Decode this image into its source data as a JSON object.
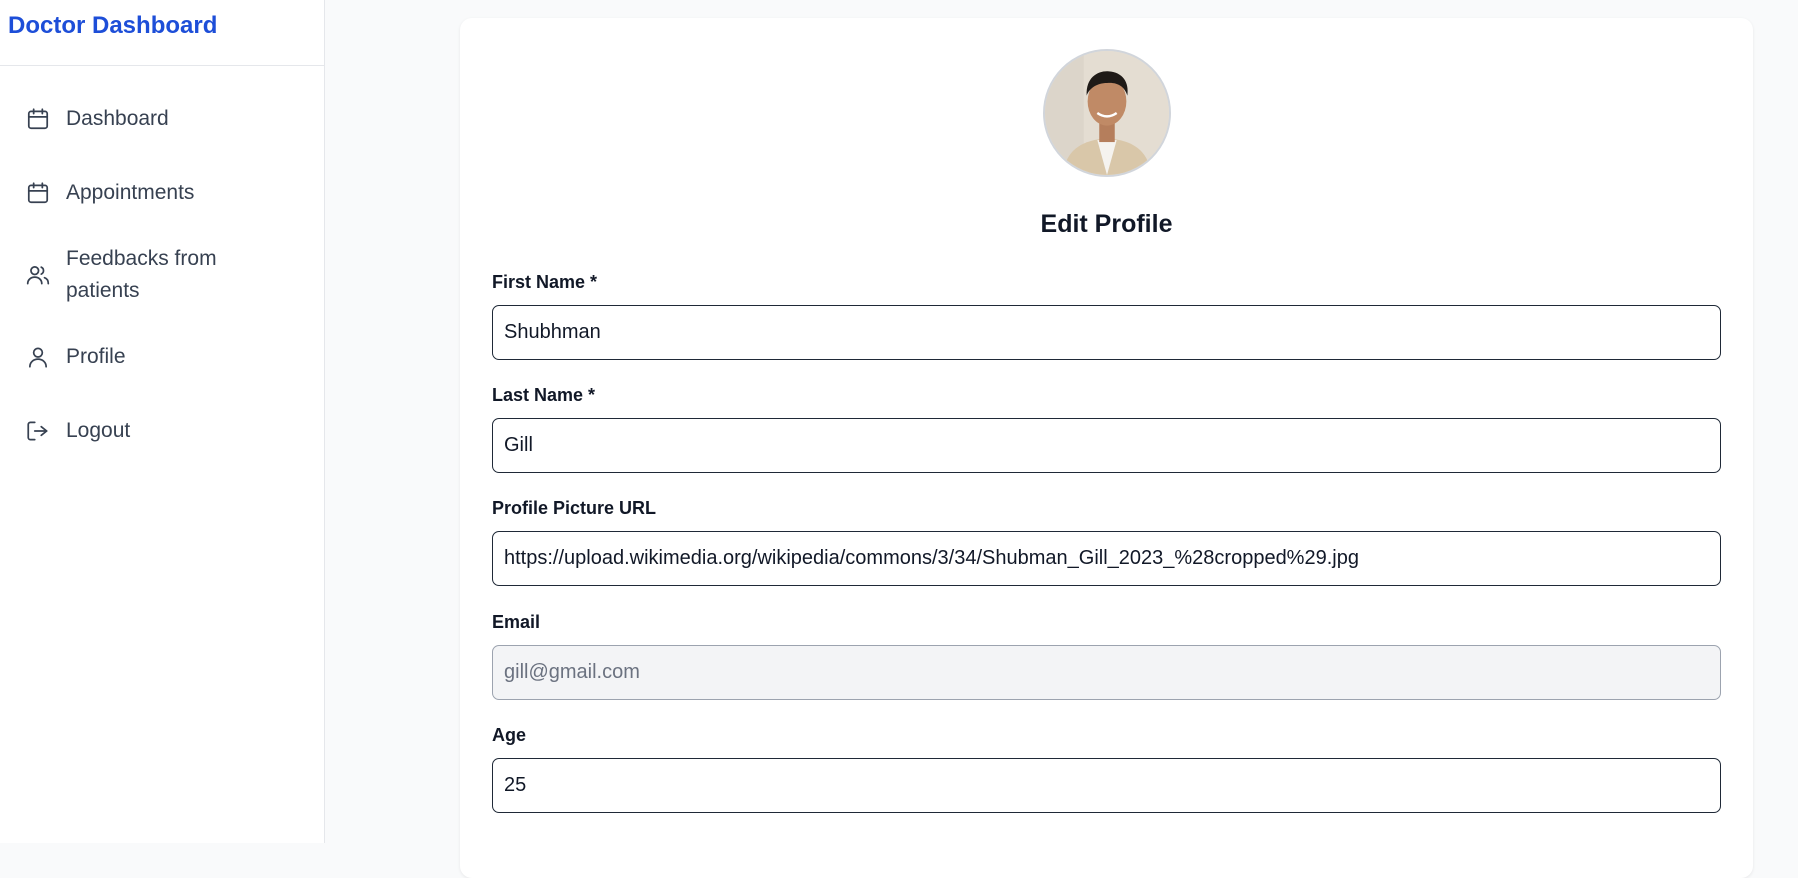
{
  "sidebar": {
    "brand": "Doctor Dashboard",
    "items": [
      {
        "label": "Dashboard",
        "icon": "calendar-icon"
      },
      {
        "label": "Appointments",
        "icon": "calendar-icon"
      },
      {
        "label": "Feedbacks from patients",
        "icon": "users-icon"
      },
      {
        "label": "Profile",
        "icon": "user-icon"
      },
      {
        "label": "Logout",
        "icon": "logout-icon"
      }
    ]
  },
  "profile": {
    "title": "Edit Profile",
    "avatar_icon": "profile-photo",
    "fields": {
      "first_name": {
        "label": "First Name *",
        "value": "Shubhman"
      },
      "last_name": {
        "label": "Last Name *",
        "value": "Gill"
      },
      "picture_url": {
        "label": "Profile Picture URL",
        "value": "https://upload.wikimedia.org/wikipedia/commons/3/34/Shubman_Gill_2023_%28cropped%29.jpg"
      },
      "email": {
        "label": "Email",
        "value": "gill@gmail.com"
      },
      "age": {
        "label": "Age",
        "value": "25"
      }
    }
  },
  "colors": {
    "brand": "#1d4ed8",
    "page_bg": "#f9fafb",
    "text": "#111827",
    "nav_text": "#374151"
  }
}
